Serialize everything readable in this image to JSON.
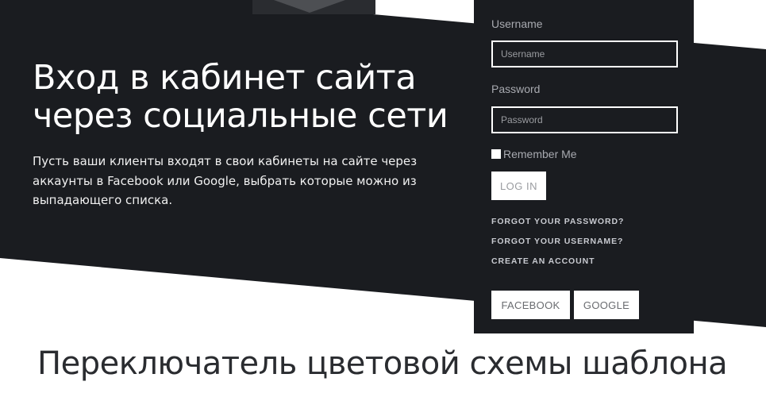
{
  "hero": {
    "title_line1": "Вход в кабинет сайта",
    "title_line2": "через социальные сети",
    "description": "Пусть ваши клиенты входят в свои кабинеты на сайте через аккаунты в Facebook или Google, выбрать которые можно из выпадающего списка."
  },
  "login": {
    "username_label": "Username",
    "username_placeholder": "Username",
    "password_label": "Password",
    "password_placeholder": "Password",
    "remember_label": "Remember Me",
    "remember_checked": false,
    "login_button": "LOG IN",
    "links": {
      "forgot_password": "FORGOT YOUR PASSWORD?",
      "forgot_username": "FORGOT YOUR USERNAME?",
      "create_account": "CREATE AN ACCOUNT"
    },
    "social": {
      "facebook": "FACEBOOK",
      "google": "GOOGLE"
    }
  },
  "section": {
    "title": "Переключатель цветовой схемы шаблона"
  },
  "colors": {
    "dark_bg": "#1a1c20",
    "page_bg": "#ffffff",
    "field_border": "#ffffff",
    "label_text": "#a8aab0"
  }
}
